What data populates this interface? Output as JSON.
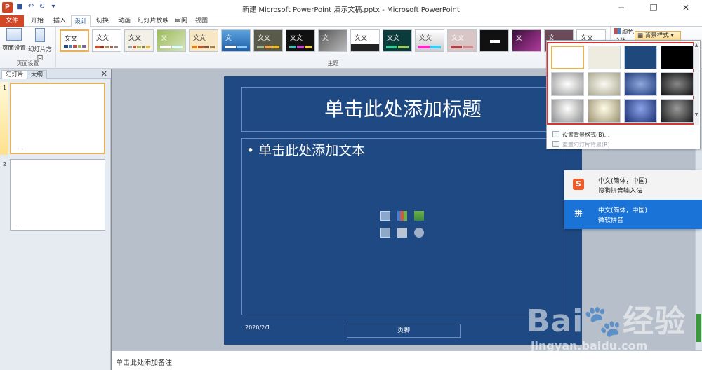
{
  "window": {
    "title": "新建 Microsoft PowerPoint 演示文稿.pptx - Microsoft PowerPoint",
    "app_logo": "P",
    "controls": [
      "−",
      "❐",
      "✕"
    ]
  },
  "ribbon_tabs": {
    "file": "文件",
    "items": [
      "开始",
      "插入",
      "设计",
      "切换",
      "动画",
      "幻灯片放映",
      "审阅",
      "视图"
    ],
    "active": "设计"
  },
  "ribbon": {
    "page_setup_group": "页面设置",
    "page_setup_btn": "页面设置",
    "slide_orientation_btn": "幻灯片方向",
    "themes_group": "主题",
    "theme_label": "文文",
    "theme_label_short": "文",
    "colors_btn": "颜色",
    "fonts_btn": "文体",
    "bg_style_btn": "背景样式"
  },
  "left_pane": {
    "tab_slides": "幻灯片",
    "tab_outline": "大纲",
    "close": "✕",
    "slide_numbers": [
      "1",
      "2"
    ],
    "thumb_dots": "....."
  },
  "slide": {
    "title": "单击此处添加标题",
    "body": "• 单击此处添加文本",
    "date": "2020/2/1",
    "footer": "页脚",
    "bg_color": "#1f4983"
  },
  "notes": {
    "placeholder": "单击此处添加备注"
  },
  "bg_dropdown": {
    "menu_format": "设置背景格式(B)...",
    "menu_reset": "重置幻灯片背景(R)",
    "scroll_up": "▲",
    "scroll_down": "▼"
  },
  "ime": {
    "items": [
      {
        "line1": "中文(简体，中国)",
        "line2": "搜狗拼音输入法",
        "icon": "S"
      },
      {
        "line1": "中文(简体，中国)",
        "line2": "微软拼音",
        "icon": "拼"
      }
    ]
  },
  "watermark": {
    "logo": "Bai🐾经验",
    "url": "jingyan.baidu.com"
  }
}
